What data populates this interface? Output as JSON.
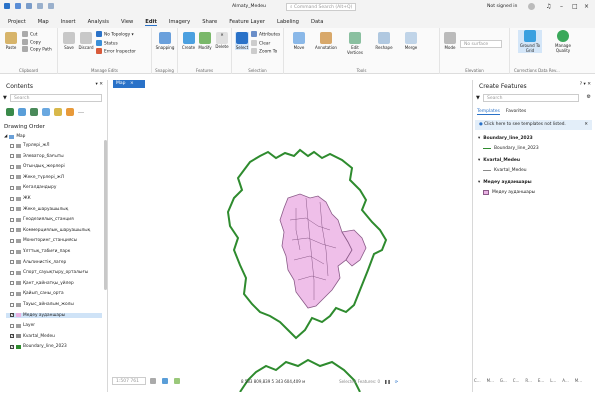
{
  "window": {
    "title": "Almaty_Medeu",
    "search_placeholder": "Command Search (Alt+Q)",
    "signin": "Not signed in"
  },
  "menu": {
    "tabs": [
      "Project",
      "Map",
      "Insert",
      "Analysis",
      "View",
      "Edit",
      "Imagery",
      "Share",
      "Feature Layer",
      "Labeling",
      "Data"
    ],
    "active": "Edit"
  },
  "ribbon": {
    "clipboard": {
      "paste": "Paste",
      "cut": "Cut",
      "copy": "Copy",
      "copy_path": "Copy Path",
      "label": "Clipboard"
    },
    "manage_edits": {
      "save": "Save",
      "discard": "Discard",
      "topology": "No Topology",
      "status": "Status",
      "error_inspector": "Error Inspector",
      "label": "Manage Edits"
    },
    "snapping": {
      "btn": "Snapping",
      "label": "Snapping"
    },
    "features": {
      "create": "Create",
      "modify": "Modify",
      "delete": "Delete",
      "label": "Features"
    },
    "selection": {
      "select": "Select",
      "attributes": "Attributes",
      "clear": "Clear",
      "zoom_to": "Zoom To",
      "label": "Selection"
    },
    "tools": {
      "move": "Move",
      "annotation": "Annotation",
      "edit_vertices": "Edit Vertices",
      "reshape": "Reshape",
      "merge": "Merge",
      "label": "Tools"
    },
    "elevation": {
      "mode": "Mode",
      "surface": "No surface",
      "label": "Elevation"
    },
    "corrections": {
      "ground": "Ground To Grid",
      "manage": "Manage Quality",
      "label": "Corrections",
      "label2": "Data Rev..."
    }
  },
  "contents": {
    "title": "Contents",
    "search_placeholder": "Search",
    "section": "Drawing Order",
    "map_label": "Map",
    "layers": [
      {
        "name": "Түрлері_жЛ",
        "checked": false,
        "color": "#a0a0a0"
      },
      {
        "name": "Элеватор_бағыты",
        "checked": false,
        "color": "#a0a0a0"
      },
      {
        "name": "Отындық_жерлері",
        "checked": false,
        "color": "#a0a0a0"
      },
      {
        "name": "Жеке_түрлері_жЛ",
        "checked": false,
        "color": "#a0a0a0"
      },
      {
        "name": "Көгалдандыру",
        "checked": false,
        "color": "#a0a0a0"
      },
      {
        "name": "ЖК",
        "checked": false,
        "color": "#a0a0a0"
      },
      {
        "name": "Жеке_шаруашылық",
        "checked": false,
        "color": "#a0a0a0"
      },
      {
        "name": "Геодезиялық_станция",
        "checked": false,
        "color": "#a0a0a0"
      },
      {
        "name": "Коммерциялық_шаруашылық",
        "checked": false,
        "color": "#a0a0a0"
      },
      {
        "name": "Мониторинг_станциясы",
        "checked": false,
        "color": "#a0a0a0"
      },
      {
        "name": "Ұлттық_табиғи_парк",
        "checked": false,
        "color": "#a0a0a0"
      },
      {
        "name": "Альпинистік_лагер",
        "checked": false,
        "color": "#a0a0a0"
      },
      {
        "name": "Спорт_сауықтыру_орталығы",
        "checked": false,
        "color": "#a0a0a0"
      },
      {
        "name": "Қант_қайнатқы_үйлер",
        "checked": false,
        "color": "#a0a0a0"
      },
      {
        "name": "Қайып_саны_орта",
        "checked": false,
        "color": "#a0a0a0"
      },
      {
        "name": "Тауыс_айналым_жолы",
        "checked": false,
        "color": "#a0a0a0"
      },
      {
        "name": "Медеу ауданшары",
        "checked": true,
        "color": "#e9b2e4",
        "selected": true
      },
      {
        "name": "Layer",
        "checked": false,
        "color": "#a0a0a0"
      },
      {
        "name": "Kvartal_Medeu",
        "checked": true,
        "color": "#8a8a8a"
      },
      {
        "name": "Boundary_line_2023",
        "checked": true,
        "color": "#2e8b2e"
      }
    ]
  },
  "map": {
    "tab": "Map",
    "scale": "1:507 761",
    "coords": "8 583 809,839 5 343 604,409 м",
    "selected": "Selected Features: 0"
  },
  "create_features": {
    "title": "Create Features",
    "search_placeholder": "Search",
    "tab_templates": "Templates",
    "tab_favorites": "Favorites",
    "info": "Click here to see templates not listed.",
    "groups": [
      {
        "header": "Boundary_line_2023",
        "item": "Boundary_line_2023",
        "color": "#2e8b2e",
        "kind": "line"
      },
      {
        "header": "Kvartal_Medeu",
        "item": "Kvartal_Medeu",
        "color": "#8a8a8a",
        "kind": "line"
      },
      {
        "header": "Медеу ауданшары",
        "item": "Медеу ауданшары",
        "color": "#e9b2e4",
        "kind": "poly"
      }
    ],
    "bottom_tabs": [
      "C...",
      "M...",
      "G...",
      "C...",
      "R...",
      "E...",
      "L...",
      "A...",
      "M..."
    ]
  },
  "colors": {
    "accent": "#2a72c8",
    "boundary": "#2e8b2e",
    "district_fill": "#efbfe9",
    "district_stroke": "#8a5a88"
  }
}
